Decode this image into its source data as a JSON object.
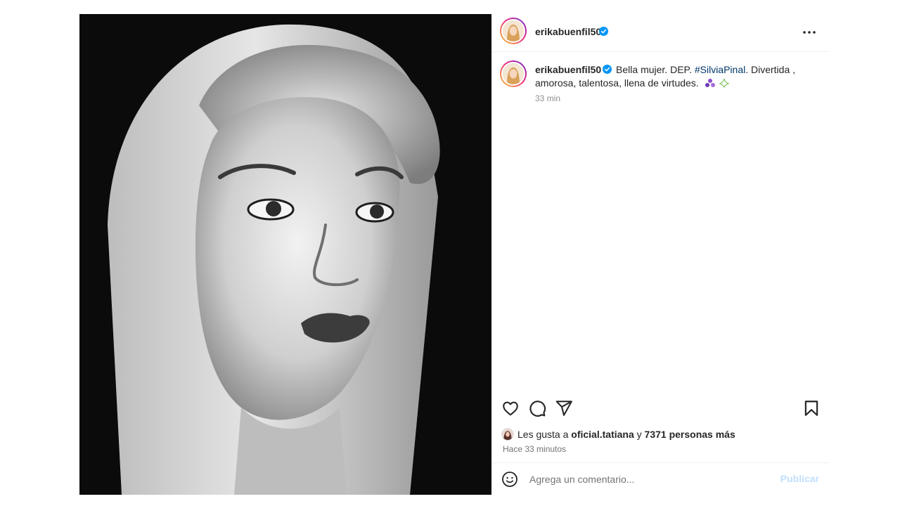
{
  "post": {
    "author": "erikabuenfil50",
    "verified": true,
    "image_description_icon": "portrait-photo",
    "caption": {
      "username": "erikabuenfil50",
      "text_before": " Bella mujer. DEP. ",
      "hashtag": "#SilviaPinal",
      "text_after": ". Divertida , amorosa, talentosa, llena de virtudes.",
      "emojis": [
        "purple-heart-cluster-emoji",
        "sparkles-emoji"
      ],
      "time": "33 min"
    },
    "likes": {
      "prefix": "Les gusta a ",
      "user": "oficial.tatiana",
      "joiner": " y ",
      "count_text": "7371 personas más"
    },
    "posted_ago": "Hace 33 minutos",
    "comment": {
      "placeholder": "Agrega un comentario...",
      "publish_label": "Publicar"
    }
  },
  "icons": {
    "verified": "verified-badge-icon",
    "more": "more-options-icon",
    "like": "heart-icon",
    "comment": "comment-icon",
    "share": "send-icon",
    "save": "bookmark-icon",
    "emoji": "smiley-icon"
  },
  "colors": {
    "verified_blue": "#0095f6",
    "hashtag": "#00376b",
    "publish_disabled": "#c0dffd",
    "muted_text": "#737373"
  }
}
